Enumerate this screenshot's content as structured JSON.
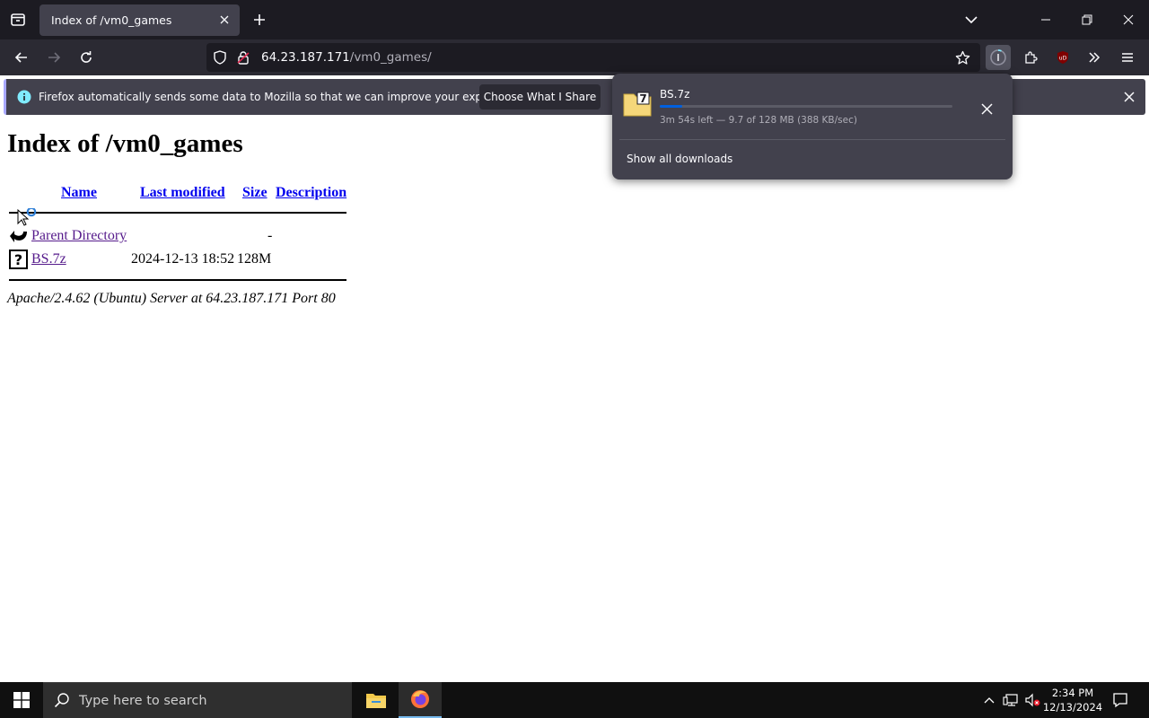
{
  "browser": {
    "tab": {
      "title": "Index of /vm0_games"
    },
    "url": {
      "host": "64.23.187.171",
      "path": "/vm0_games/"
    },
    "notification": {
      "message": "Firefox automatically sends some data to Mozilla so that we can improve your experience.",
      "button": "Choose What I Share"
    },
    "colors": {
      "chrome_dark": "#1c1b22",
      "toolbar": "#2b2a33",
      "panel": "#42414d",
      "accent": "#0060df"
    }
  },
  "downloads_panel": {
    "file_name": "BS.7z",
    "status": "3m 54s left — 9.7 of 128 MB (388 KB/sec)",
    "progress_fraction": 0.076,
    "show_all": "Show all downloads"
  },
  "page": {
    "title": "Index of /vm0_games",
    "columns": {
      "name": "Name",
      "last_modified": "Last modified",
      "size": "Size",
      "description": "Description"
    },
    "rows": [
      {
        "name": "Parent Directory",
        "modified": "",
        "size": "-",
        "icon": "back-icon"
      },
      {
        "name": "BS.7z",
        "modified": "2024-12-13 18:52",
        "size": "128M",
        "icon": "unknown-file-icon"
      }
    ],
    "address": "Apache/2.4.62 (Ubuntu) Server at 64.23.187.171 Port 80"
  },
  "taskbar": {
    "search_placeholder": "Type here to search",
    "time": "2:34 PM",
    "date": "12/13/2024"
  }
}
